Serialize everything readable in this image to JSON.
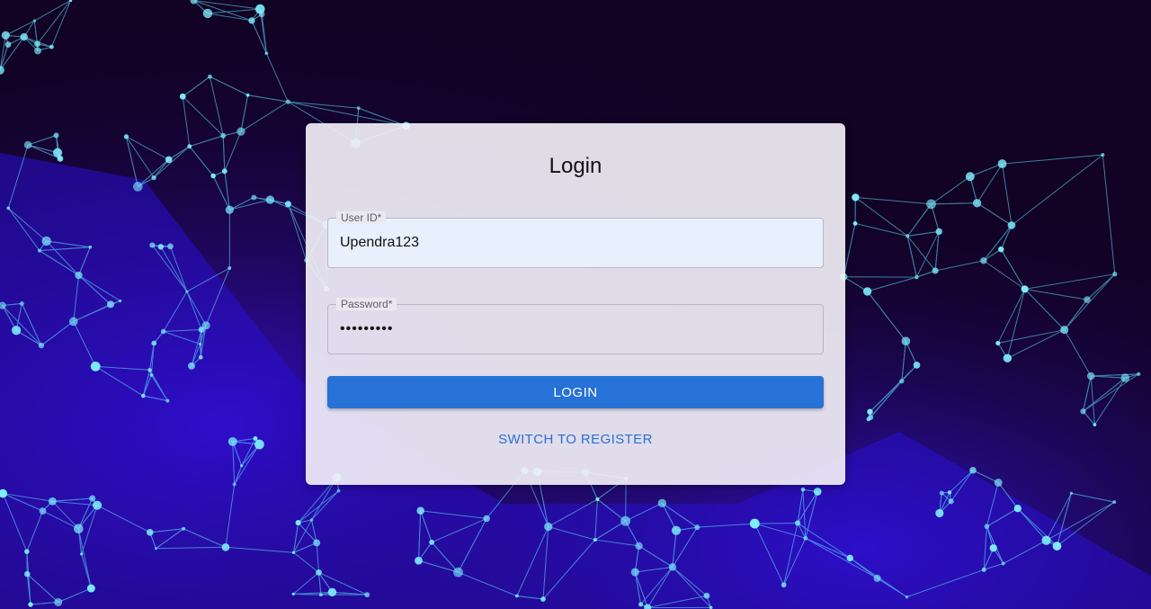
{
  "login": {
    "title": "Login",
    "user_id_label": "User ID*",
    "user_id_value": "Upendra123",
    "password_label": "Password*",
    "password_value": "•••••••••",
    "login_button": "LOGIN",
    "switch_button": "SWITCH TO REGISTER"
  },
  "colors": {
    "background": "#120224",
    "network_glow": "#5fe6ff",
    "primary_button": "#2672d6",
    "link": "#2a6fd1"
  }
}
